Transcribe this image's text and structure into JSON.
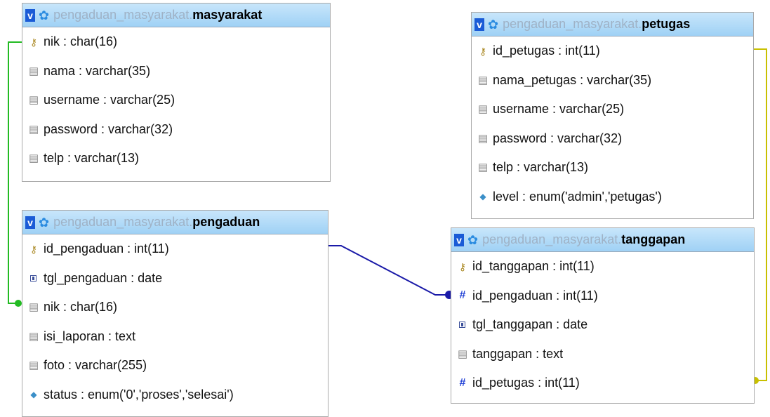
{
  "database": "pengaduan_masyarakat.",
  "colors": {
    "header_top": "#c8e6fb",
    "header_bottom": "#9fd1f5",
    "rel_green": "#22bb22",
    "rel_blue": "#1a1aa8",
    "rel_yellow": "#c8c000"
  },
  "tables": {
    "masyarakat": {
      "name": "masyarakat",
      "columns": [
        {
          "icon": "key-icon",
          "text": "nik : char(16)"
        },
        {
          "icon": "column-icon",
          "text": "nama : varchar(35)"
        },
        {
          "icon": "column-icon",
          "text": "username : varchar(25)"
        },
        {
          "icon": "column-icon",
          "text": "password : varchar(32)"
        },
        {
          "icon": "column-icon",
          "text": "telp : varchar(13)"
        }
      ]
    },
    "petugas": {
      "name": "petugas",
      "columns": [
        {
          "icon": "key-icon",
          "text": "id_petugas : int(11)"
        },
        {
          "icon": "column-icon",
          "text": "nama_petugas : varchar(35)"
        },
        {
          "icon": "column-icon",
          "text": "username : varchar(25)"
        },
        {
          "icon": "column-icon",
          "text": "password : varchar(32)"
        },
        {
          "icon": "column-icon",
          "text": "telp : varchar(13)"
        },
        {
          "icon": "enum-icon",
          "text": "level : enum('admin','petugas')"
        }
      ]
    },
    "pengaduan": {
      "name": "pengaduan",
      "columns": [
        {
          "icon": "key-icon",
          "text": "id_pengaduan : int(11)"
        },
        {
          "icon": "date-icon",
          "text": "tgl_pengaduan : date"
        },
        {
          "icon": "column-icon",
          "text": "nik : char(16)"
        },
        {
          "icon": "column-icon",
          "text": "isi_laporan : text"
        },
        {
          "icon": "column-icon",
          "text": "foto : varchar(255)"
        },
        {
          "icon": "enum-icon",
          "text": "status : enum('0','proses','selesai')"
        }
      ]
    },
    "tanggapan": {
      "name": "tanggapan",
      "columns": [
        {
          "icon": "key-icon",
          "text": "id_tanggapan : int(11)"
        },
        {
          "icon": "number-icon",
          "text": "id_pengaduan : int(11)"
        },
        {
          "icon": "date-icon",
          "text": "tgl_tanggapan : date"
        },
        {
          "icon": "column-icon",
          "text": "tanggapan : text"
        },
        {
          "icon": "number-icon",
          "text": "id_petugas : int(11)"
        }
      ]
    }
  }
}
